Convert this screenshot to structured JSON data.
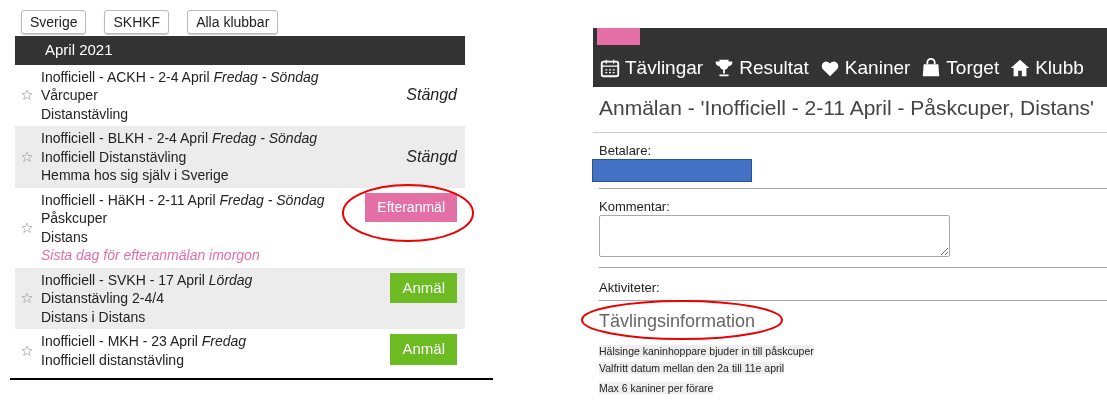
{
  "left_panel": {
    "filters": [
      "Sverige",
      "SKHKF",
      "Alla klubbar"
    ],
    "month_header": "April 2021",
    "events": [
      {
        "title": "Inofficiell - ACKH - 2-4 April *Fredag - Söndag*",
        "name": "Vårcuper",
        "class": "Distanstävling",
        "kind": "closed",
        "action": "Stängd"
      },
      {
        "title": "Inofficiell - BLKH - 2-4 April *Fredag - Söndag*",
        "name": "Inofficiell Distanstävling",
        "class": "Hemma hos sig själv i Sverige",
        "kind": "closed",
        "action": "Stängd"
      },
      {
        "title": "Inofficiell - HäKH - 2-11 April *Fredag - Söndag*",
        "name": "Påskcuper",
        "class": "Distans",
        "note": "Sista dag för efteranmälan imorgon",
        "kind": "late",
        "action": "Efteranmäl"
      },
      {
        "title": "Inofficiell - SVKH - 17 April *Lördag*",
        "name": "Distanstävling 2-4/4",
        "class": "Distans i Distans",
        "kind": "open",
        "action": "Anmäl"
      },
      {
        "title": "Inofficiell - MKH - 23 April *Fredag*",
        "name": "Inofficiell distanstävling",
        "kind": "open",
        "action": "Anmäl"
      }
    ]
  },
  "right_panel": {
    "nav": [
      {
        "label": "Tävlingar"
      },
      {
        "label": "Resultat"
      },
      {
        "label": "Kaniner"
      },
      {
        "label": "Torget"
      },
      {
        "label": "Klubb"
      }
    ],
    "title": "Anmälan - 'Inofficiell - 2-11 April - Påskcuper, Distans'",
    "payer_label": "Betalare:",
    "comment_label": "Kommentar:",
    "activities_label": "Aktiviteter:",
    "info_heading": "Tävlingsinformation",
    "info_lines": [
      "Hälsinge kaninhoppare bjuder in till påskcuper",
      "Valfritt datum mellan den 2a till 11e april",
      "Max 6 kaniner per förare"
    ]
  }
}
